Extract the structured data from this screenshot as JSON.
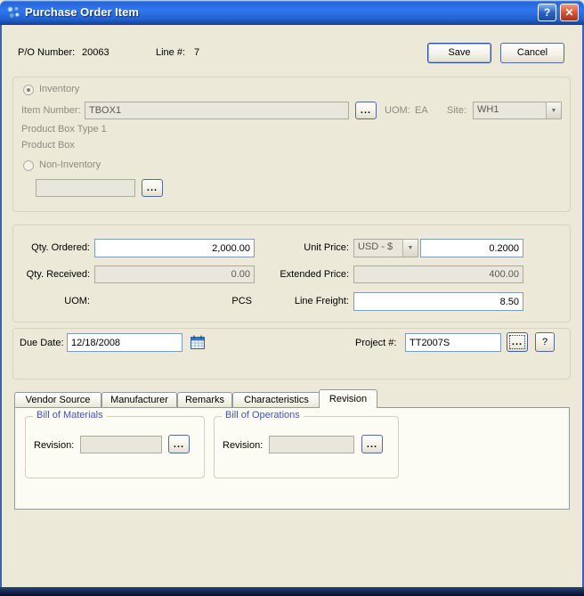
{
  "window": {
    "title": "Purchase Order Item"
  },
  "glyphs": {
    "help": "?",
    "close": "✕",
    "browse": "...",
    "dropdown_arrow": "▼"
  },
  "header": {
    "po_label": "P/O Number:",
    "po_value": "20063",
    "line_label": "Line #:",
    "line_value": "7",
    "save": "Save",
    "cancel": "Cancel"
  },
  "inventory": {
    "inventory_radio_label": "Inventory",
    "item_number_label": "Item Number:",
    "item_number_value": "TBOX1",
    "uom_label": "UOM:",
    "uom_value": "EA",
    "site_label": "Site:",
    "site_value": "WH1",
    "description_line1": "Product Box Type 1",
    "description_line2": "Product Box",
    "non_inventory_radio_label": "Non-Inventory",
    "non_inventory_value": ""
  },
  "pricing": {
    "qty_ordered_label": "Qty. Ordered:",
    "qty_ordered_value": "2,000.00",
    "qty_received_label": "Qty. Received:",
    "qty_received_value": "0.00",
    "uom_label": "UOM:",
    "uom_value": "PCS",
    "unit_price_label": "Unit Price:",
    "currency_value": "USD - $",
    "unit_price_value": "0.2000",
    "extended_price_label": "Extended Price:",
    "extended_price_value": "400.00",
    "line_freight_label": "Line Freight:",
    "line_freight_value": "8.50"
  },
  "schedule": {
    "due_date_label": "Due Date:",
    "due_date_value": "12/18/2008",
    "project_label": "Project #:",
    "project_value": "TT2007S"
  },
  "tabs": {
    "items": [
      {
        "label": "Vendor Source"
      },
      {
        "label": "Manufacturer"
      },
      {
        "label": "Remarks"
      },
      {
        "label": "Characteristics"
      },
      {
        "label": "Revision"
      }
    ]
  },
  "revision": {
    "bill_of_materials_label": "Bill of Materials",
    "bom_revision_label": "Revision:",
    "bom_revision_value": "",
    "bill_of_operations_label": "Bill of Operations",
    "boo_revision_label": "Revision:",
    "boo_revision_value": ""
  }
}
